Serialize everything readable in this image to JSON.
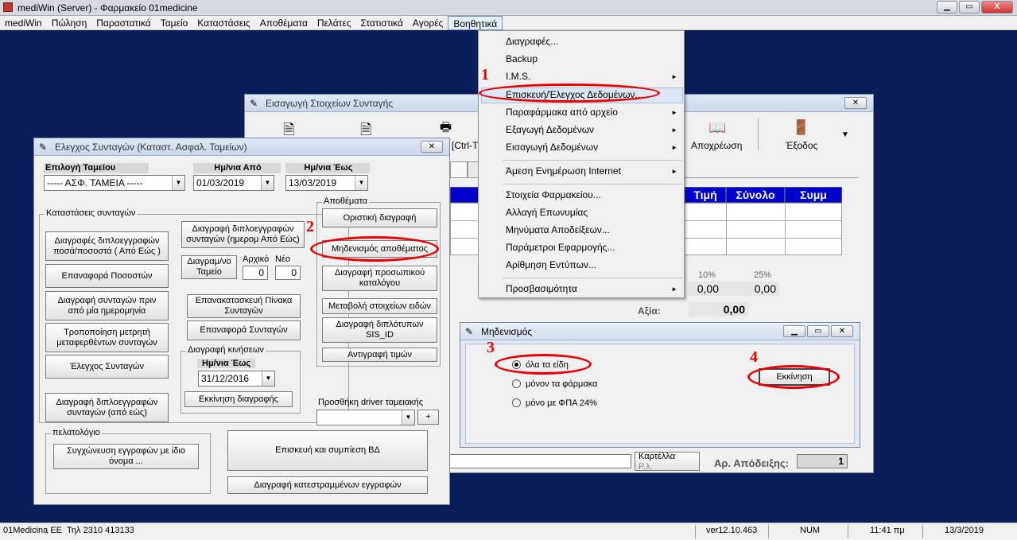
{
  "app": {
    "title": "mediWin (Server) - Φαρμακείο 01medicine",
    "min": "▁",
    "max": "▭",
    "close": "X"
  },
  "menubar": [
    "mediWin",
    "Πώληση",
    "Παραστατικά",
    "Ταμείο",
    "Καταστάσεις",
    "Αποθέματα",
    "Πελάτες",
    "Στατιστικά",
    "Αγορές",
    "Βοηθητικά"
  ],
  "dropdown": {
    "items": [
      "Διαγραφές...",
      "Backup",
      "I.M.S.",
      "Επισκευή/Έλεγχος Δεδομένων...",
      "Παραφάρμακα από αρχείο",
      "Εξαγωγή Δεδομένων",
      "Εισαγωγή Δεδομένων",
      "Άμεση Ενημέρωση Internet",
      "Στοιχεία Φαρμακείου...",
      "Αλλαγή Επωνυμίας",
      "Μηνύματα Αποδείξεων...",
      "Παράμετροι Εφαρμογής...",
      "Αρίθμηση Εντύπων...",
      "Προσβασιμότητα"
    ],
    "submenu_arrow": "►"
  },
  "bgwin": {
    "title": "Εισαγωγή Στοιχείων Συνταγής",
    "close": "✕",
    "toolbar_partial": "[Ctrl-T",
    "apoxrewsi": "Αποχρέωση",
    "exodos": "Έξοδος",
    "more": "▼",
    "grid_headers": [
      "Τιμή",
      "Σύνολο",
      "Συμμ"
    ],
    "pct10": "10%",
    "pct25": "25%",
    "val10": "0,00",
    "val25": "0,00",
    "axia_label": "Αξία:",
    "axia_value": "0,00",
    "kartella": "Καρτέλλα",
    "kartella2": "Ρ.λ.",
    "ar_apodeixis": "Αρ. Απόδειξης:",
    "ar_value": "1"
  },
  "main": {
    "title": "Ελεγχος Συνταγών (Καταστ. Ασφαλ. Ταμείων)",
    "close": "✕",
    "epilogi_label": "Επιλογή Ταμείου",
    "epilogi_value": "----- ΑΣΦ. ΤΑΜΕΙΑ -----",
    "apo_label": "Ημ/νια Από",
    "apo_value": "01/03/2019",
    "eos_label": "Ημ/νια Έως",
    "eos_value": "13/03/2019",
    "group_katastaseis": "Καταστάσεις συνταγών",
    "b_diagrafes": "Διαγραφές διπλοεγγραφών ποσά/ποσοστά ( Από Εώς )",
    "b_epanafora_pos": "Επαναφορά Ποσοστών",
    "b_diagrafi_prin": "Διαγραφή συνταγών πριν από μία ημερομηνία",
    "b_tropopoiisi": "Τροποποίηση μετρητή μεταφερθέντων συνταγών",
    "b_elegxos": "Έλεγχος Συνταγών",
    "b_diagrafi_dipl_syn": "Διαγραφή διπλοεγγραφών συνταγών (από εώς)",
    "b_diagrafi_imer": "Διαγραφή διπλοεγγραφών συνταγών (ημερομ Από Εώς)",
    "diagram_tameio": "Διαγραμ/νο Ταμείο",
    "arxiko": "Αρχικό",
    "neo": "Νέο",
    "arxiko_val": "0",
    "neo_val": "0",
    "b_epanakat": "Επανακατασκευή Πίνακα Συνταγών",
    "b_epanafora_syn": "Επαναφορά Συνταγών",
    "group_kiniseis": "Διαγραφή κινήσεων",
    "kin_eos_label": "Ημ/νια Έως",
    "kin_eos_value": "31/12/2016",
    "b_ekkinisi_diag": "Εκκίνηση διαγραφής",
    "group_apothemata": "Αποθέματα",
    "b_oristiki": "Οριστική διαγραφή",
    "b_midenismos": "Μηδενισμός αποθέματος",
    "b_diagrafi_pros": "Διαγραφή προσωπικού καταλόγου",
    "b_metavoli": "Μεταβολή στοιχείων ειδών",
    "b_diagrafi_dipl": "Διαγραφή διπλότυπων SIS_ID",
    "b_antigrafi": "Αντιγραφή τιμών",
    "driver_label": "Προσθήκη driver ταμειακής",
    "driver_plus": "+",
    "group_pelatologio": "πελατολόγιο",
    "b_sygxwneysi": "Συγχώνευση εγγραφών με ίδιο όνομα ...",
    "b_episkevi": "Επισκευή και συμπίεση ΒΔ",
    "b_diagrafi_kat": "Διαγραφή κατεστραμμένων εγγραφών"
  },
  "midenismos": {
    "title": "Μηδενισμός",
    "min": "▁",
    "max": "▭",
    "close": "✕",
    "opt1": "όλα τα είδη",
    "opt2": "μόνον τα φάρμακα",
    "opt3": "μόνο με ΦΠΑ 24%",
    "start": "Εκκίνηση"
  },
  "annotations": {
    "n1": "1",
    "n2": "2",
    "n3": "3",
    "n4": "4"
  },
  "status": {
    "company": "01Medicina EE",
    "phone": "Τηλ 2310 413133",
    "version": "ver12.10.463",
    "num": "NUM",
    "time": "11:41 πμ",
    "date": "13/3/2019"
  }
}
